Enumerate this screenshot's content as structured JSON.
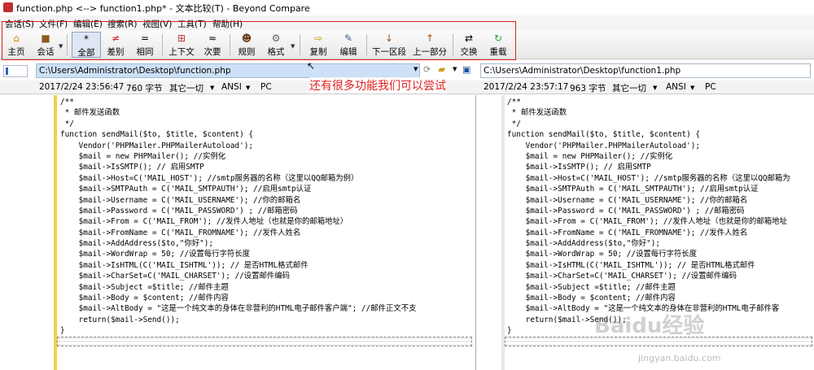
{
  "title": "function.php <--> function1.php* - 文本比较(T) - Beyond Compare",
  "menu": [
    "会话(S)",
    "文件(F)",
    "编辑(E)",
    "搜索(R)",
    "视图(V)",
    "工具(T)",
    "帮助(H)"
  ],
  "toolbar": {
    "home": "主页",
    "session": "会话",
    "all": "全部",
    "diffs": "差别",
    "same": "相同",
    "context": "上下文",
    "minor": "次要",
    "rules": "规则",
    "format": "格式",
    "copy": "复制",
    "edit": "编辑",
    "next_section": "下一区段",
    "prev_section": "上一部分",
    "swap": "交换",
    "reload": "重载"
  },
  "left": {
    "path": "C:\\Users\\Administrator\\Desktop\\function.php",
    "date": "2017/2/24 23:56:47",
    "size": "760 字节",
    "other": "其它一切",
    "encoding": "ANSI",
    "lineend": "PC"
  },
  "right": {
    "path": "C:\\Users\\Administrator\\Desktop\\function1.php",
    "date": "2017/2/24 23:57:17",
    "size": "963 字节",
    "other": "其它一切",
    "encoding": "ANSI",
    "lineend": "PC"
  },
  "annotation": "还有很多功能我们可以尝试",
  "watermark": "Baidu经验",
  "watermark_url": "jingyan.baidu.com",
  "code_left": [
    "/**",
    " * 邮件发送函数",
    " */",
    "function sendMail($to, $title, $content) {",
    "    Vendor('PHPMailer.PHPMailerAutoload');",
    "    $mail = new PHPMailer(); //实例化",
    "    $mail->IsSMTP(); // 启用SMTP",
    "    $mail->Host=C('MAIL_HOST'); //smtp服务器的名称（这里以QQ邮箱为例）",
    "    $mail->SMTPAuth = C('MAIL_SMTPAUTH'); //启用smtp认证",
    "    $mail->Username = C('MAIL_USERNAME'); //你的邮箱名",
    "    $mail->Password = C('MAIL_PASSWORD') ; //邮箱密码",
    "    $mail->From = C('MAIL_FROM'); //发件人地址（也就是你的邮箱地址）",
    "    $mail->FromName = C('MAIL_FROMNAME'); //发件人姓名",
    "    $mail->AddAddress($to,\"你好\");",
    "    $mail->WordWrap = 50; //设置每行字符长度",
    "    $mail->IsHTML(C('MAIL_ISHTML')); // 是否HTML格式邮件",
    "    $mail->CharSet=C('MAIL_CHARSET'); //设置邮件编码",
    "    $mail->Subject =$title; //邮件主题",
    "    $mail->Body = $content; //邮件内容",
    "    $mail->AltBody = \"这是一个纯文本的身体在非营利的HTML电子邮件客户端\"; //邮件正文不支",
    "    return($mail->Send());",
    "}"
  ],
  "code_right": [
    "/**",
    " * 邮件发送函数",
    " */",
    "function sendMail($to, $title, $content) {",
    "    Vendor('PHPMailer.PHPMailerAutoload');",
    "    $mail = new PHPMailer(); //实例化",
    "    $mail->IsSMTP(); // 启用SMTP",
    "    $mail->Host=C('MAIL_HOST'); //smtp服务器的名称（这里以QQ邮箱为",
    "    $mail->SMTPAuth = C('MAIL_SMTPAUTH'); //启用smtp认证",
    "    $mail->Username = C('MAIL_USERNAME'); //你的邮箱名",
    "    $mail->Password = C('MAIL_PASSWORD') ; //邮箱密码",
    "    $mail->From = C('MAIL_FROM'); //发件人地址（也就是你的邮箱地址",
    "    $mail->FromName = C('MAIL_FROMNAME'); //发件人姓名",
    "    $mail->AddAddress($to,\"你好\");",
    "    $mail->WordWrap = 50; //设置每行字符长度",
    "    $mail->IsHTML(C('MAIL_ISHTML')); // 是否HTML格式邮件",
    "    $mail->CharSet=C('MAIL_CHARSET'); //设置邮件编码",
    "    $mail->Subject =$title; //邮件主题",
    "    $mail->Body = $content; //邮件内容",
    "    $mail->AltBody = \"这是一个纯文本的身体在非营利的HTML电子邮件客",
    "    return($mail->Send());",
    "}"
  ],
  "colors": {
    "diff_gutter": "#f2d04a",
    "annotation": "#e02020",
    "selected_path": "#cce0f7",
    "toolbar_frame": "#e02020"
  }
}
